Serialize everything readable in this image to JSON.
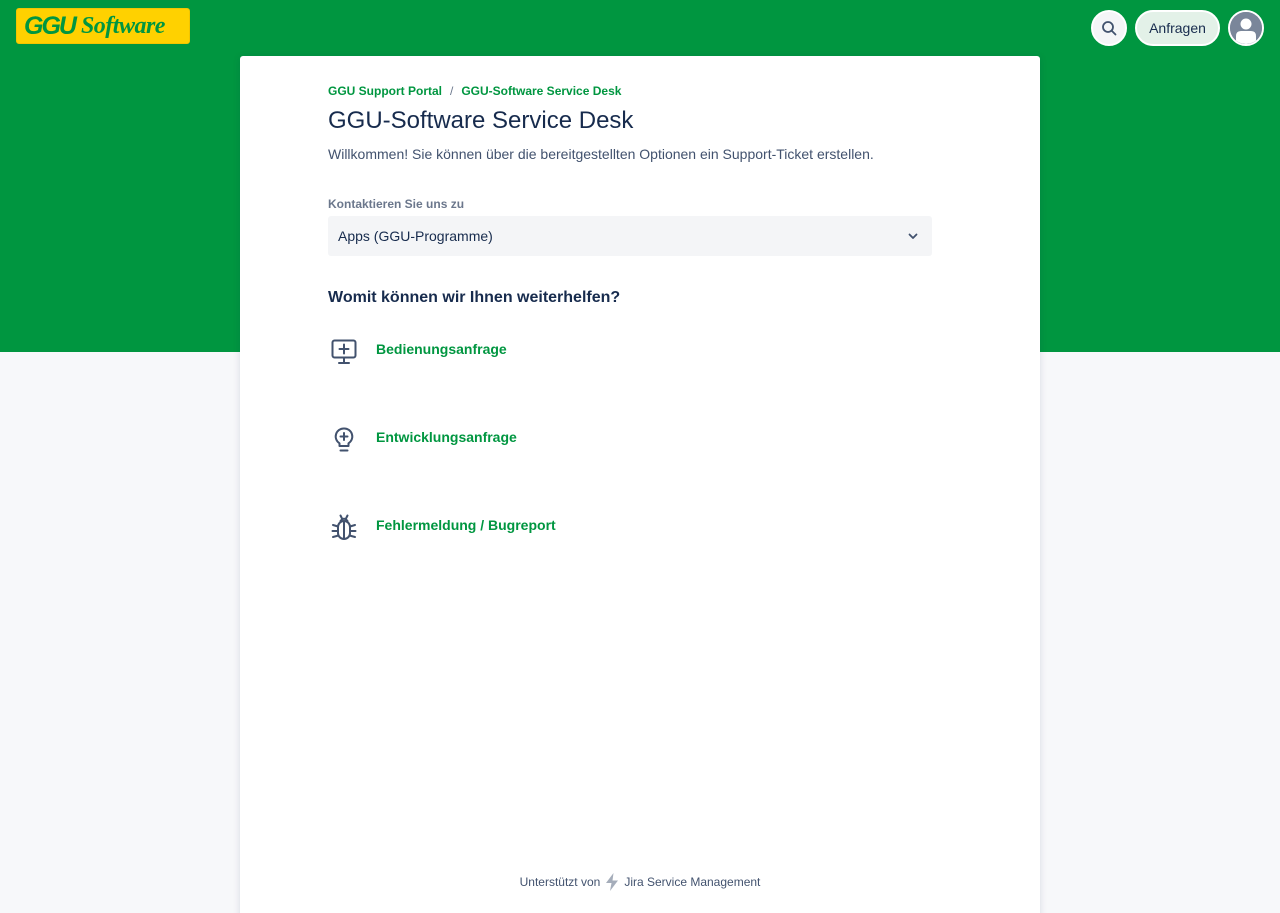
{
  "header": {
    "logo_ggu": "GGU",
    "logo_software": "Software",
    "requests_label": "Anfragen",
    "colors": {
      "brand_green": "#009640",
      "brand_yellow": "#ffd100"
    }
  },
  "breadcrumb": {
    "items": [
      {
        "label": "GGU Support Portal"
      },
      {
        "label": "GGU-Software Service Desk"
      }
    ],
    "separator": "/"
  },
  "page": {
    "title": "GGU-Software Service Desk",
    "welcome": "Willkommen! Sie können über die bereitgestellten Optionen ein Support-Ticket erstellen."
  },
  "contact": {
    "label": "Kontaktieren Sie uns zu",
    "selected": "Apps (GGU-Programme)"
  },
  "help": {
    "heading": "Womit können wir Ihnen weiterhelfen?",
    "request_types": [
      {
        "label": "Bedienungsanfrage",
        "icon": "monitor-plus-icon"
      },
      {
        "label": "Entwicklungsanfrage",
        "icon": "lightbulb-icon"
      },
      {
        "label": "Fehlermeldung / Bugreport",
        "icon": "bug-icon"
      }
    ]
  },
  "footer": {
    "prefix": "Unterstützt von",
    "product": "Jira Service Management"
  }
}
